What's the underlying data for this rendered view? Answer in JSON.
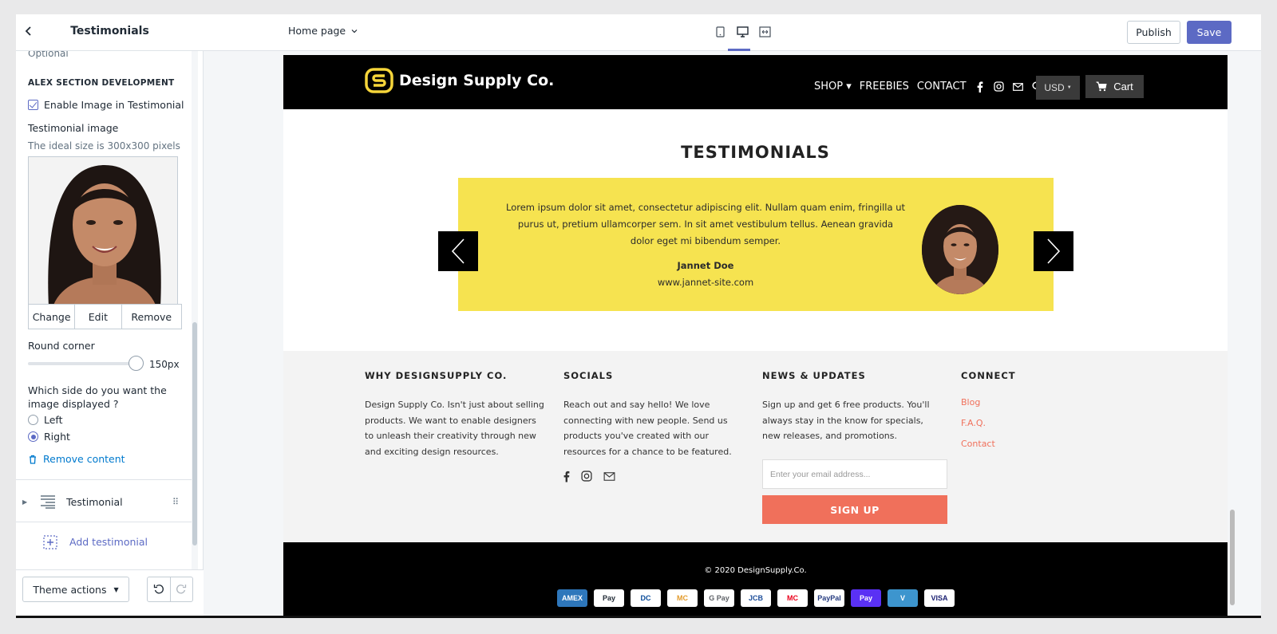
{
  "sidebar": {
    "back_icon": "chevron-left-icon",
    "title": "Testimonials",
    "optional_text": "Optional",
    "section_heading": "ALEX SECTION DEVELOPMENT",
    "enable_image_label": "Enable Image in Testimonial",
    "enable_image_checked": true,
    "image_label": "Testimonial image",
    "image_hint": "The ideal size is 300x300 pixels",
    "image_actions": [
      "Change",
      "Edit",
      "Remove"
    ],
    "round_corner_label": "Round corner",
    "round_corner_value": "150px",
    "round_corner_level": 0.95,
    "side_question": "Which side do you want the image displayed ?",
    "side_options": [
      {
        "label": "Left",
        "selected": false
      },
      {
        "label": "Right",
        "selected": true
      }
    ],
    "remove_content": "Remove content",
    "block_label": "Testimonial",
    "add_block": "Add testimonial",
    "theme_actions": "Theme actions"
  },
  "topbar": {
    "page_select": "Home page",
    "device_icons": [
      "mobile-icon",
      "desktop-icon",
      "fullscreen-icon"
    ],
    "active_device": "desktop-icon",
    "publish": "Publish",
    "save": "Save",
    "accent": "#5c6ac4"
  },
  "preview": {
    "brand": "Design Supply Co.",
    "nav": [
      "SHOP ▾",
      "FREEBIES",
      "CONTACT"
    ],
    "currency": "USD",
    "cart": "Cart",
    "section_title": "TESTIMONIALS",
    "testimonial": {
      "text": "Lorem ipsum dolor sit amet, consectetur adipiscing elit. Nullam quam enim, fringilla ut purus ut, pretium ullamcorper sem. In sit amet vestibulum tellus. Aenean gravida dolor eget mi bibendum semper.",
      "name": "Jannet Doe",
      "site": "www.jannet-site.com",
      "bg": "#f6e350"
    },
    "footer": {
      "col1_title": "WHY DESIGNSUPPLY CO.",
      "col1_text": "Design Supply Co. Isn't just about selling products. We want to enable designers to unleash their creativity through new and exciting design resources.",
      "col2_title": "SOCIALS",
      "col2_text": "Reach out and say hello! We love connecting with new people. Send us products you've created with our resources for a chance to be featured.",
      "col3_title": "NEWS & UPDATES",
      "col3_text": "Sign up and get 6 free products. You'll always stay in the know for specials, new releases, and promotions.",
      "email_placeholder": "Enter your email address...",
      "signup": "SIGN UP",
      "col4_title": "CONNECT",
      "links": [
        "Blog",
        "F.A.Q.",
        "Contact"
      ],
      "accent": "#f0705b"
    },
    "copyright": "© 2020 DesignSupply.Co.",
    "payments": [
      "AMEX",
      "Pay",
      "DC",
      "MC",
      "G Pay",
      "JCB",
      "MC",
      "PayPal",
      "Pay",
      "V",
      "VISA"
    ]
  }
}
